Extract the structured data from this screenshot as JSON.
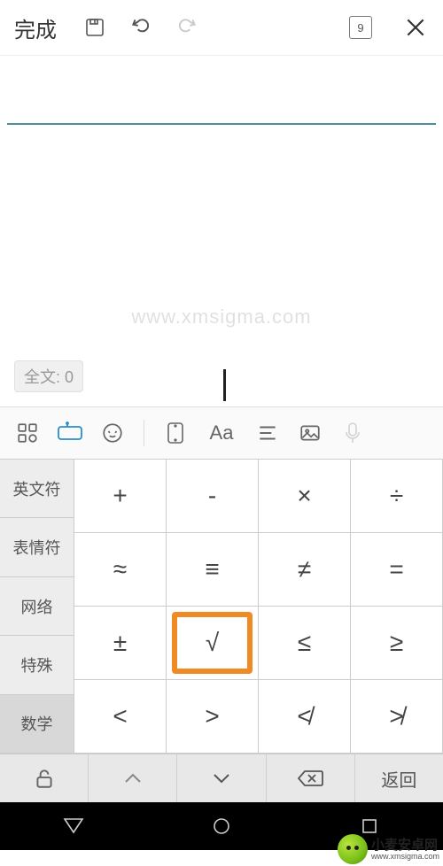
{
  "app_bar": {
    "done_label": "完成",
    "page_indicator": "9"
  },
  "doc": {
    "word_count_label": "全文: 0"
  },
  "kbd": {
    "categories": [
      "英文符",
      "表情符",
      "网络",
      "特殊",
      "数学"
    ],
    "selected_category_index": 4,
    "rows": [
      [
        "+",
        "-",
        "×",
        "÷"
      ],
      [
        "≈",
        "≡",
        "≠",
        "="
      ],
      [
        "±",
        "√",
        "≤",
        "≥"
      ],
      [
        "<",
        ">",
        "≮",
        "≯"
      ]
    ],
    "highlight": {
      "row": 2,
      "col": 1
    }
  },
  "ime_bottom": {
    "back_label": "返回"
  },
  "watermark": {
    "center": "www.xmsigma.com",
    "corner_title": "小麦安卓网",
    "corner_sub": "www.xmsigma.com"
  }
}
